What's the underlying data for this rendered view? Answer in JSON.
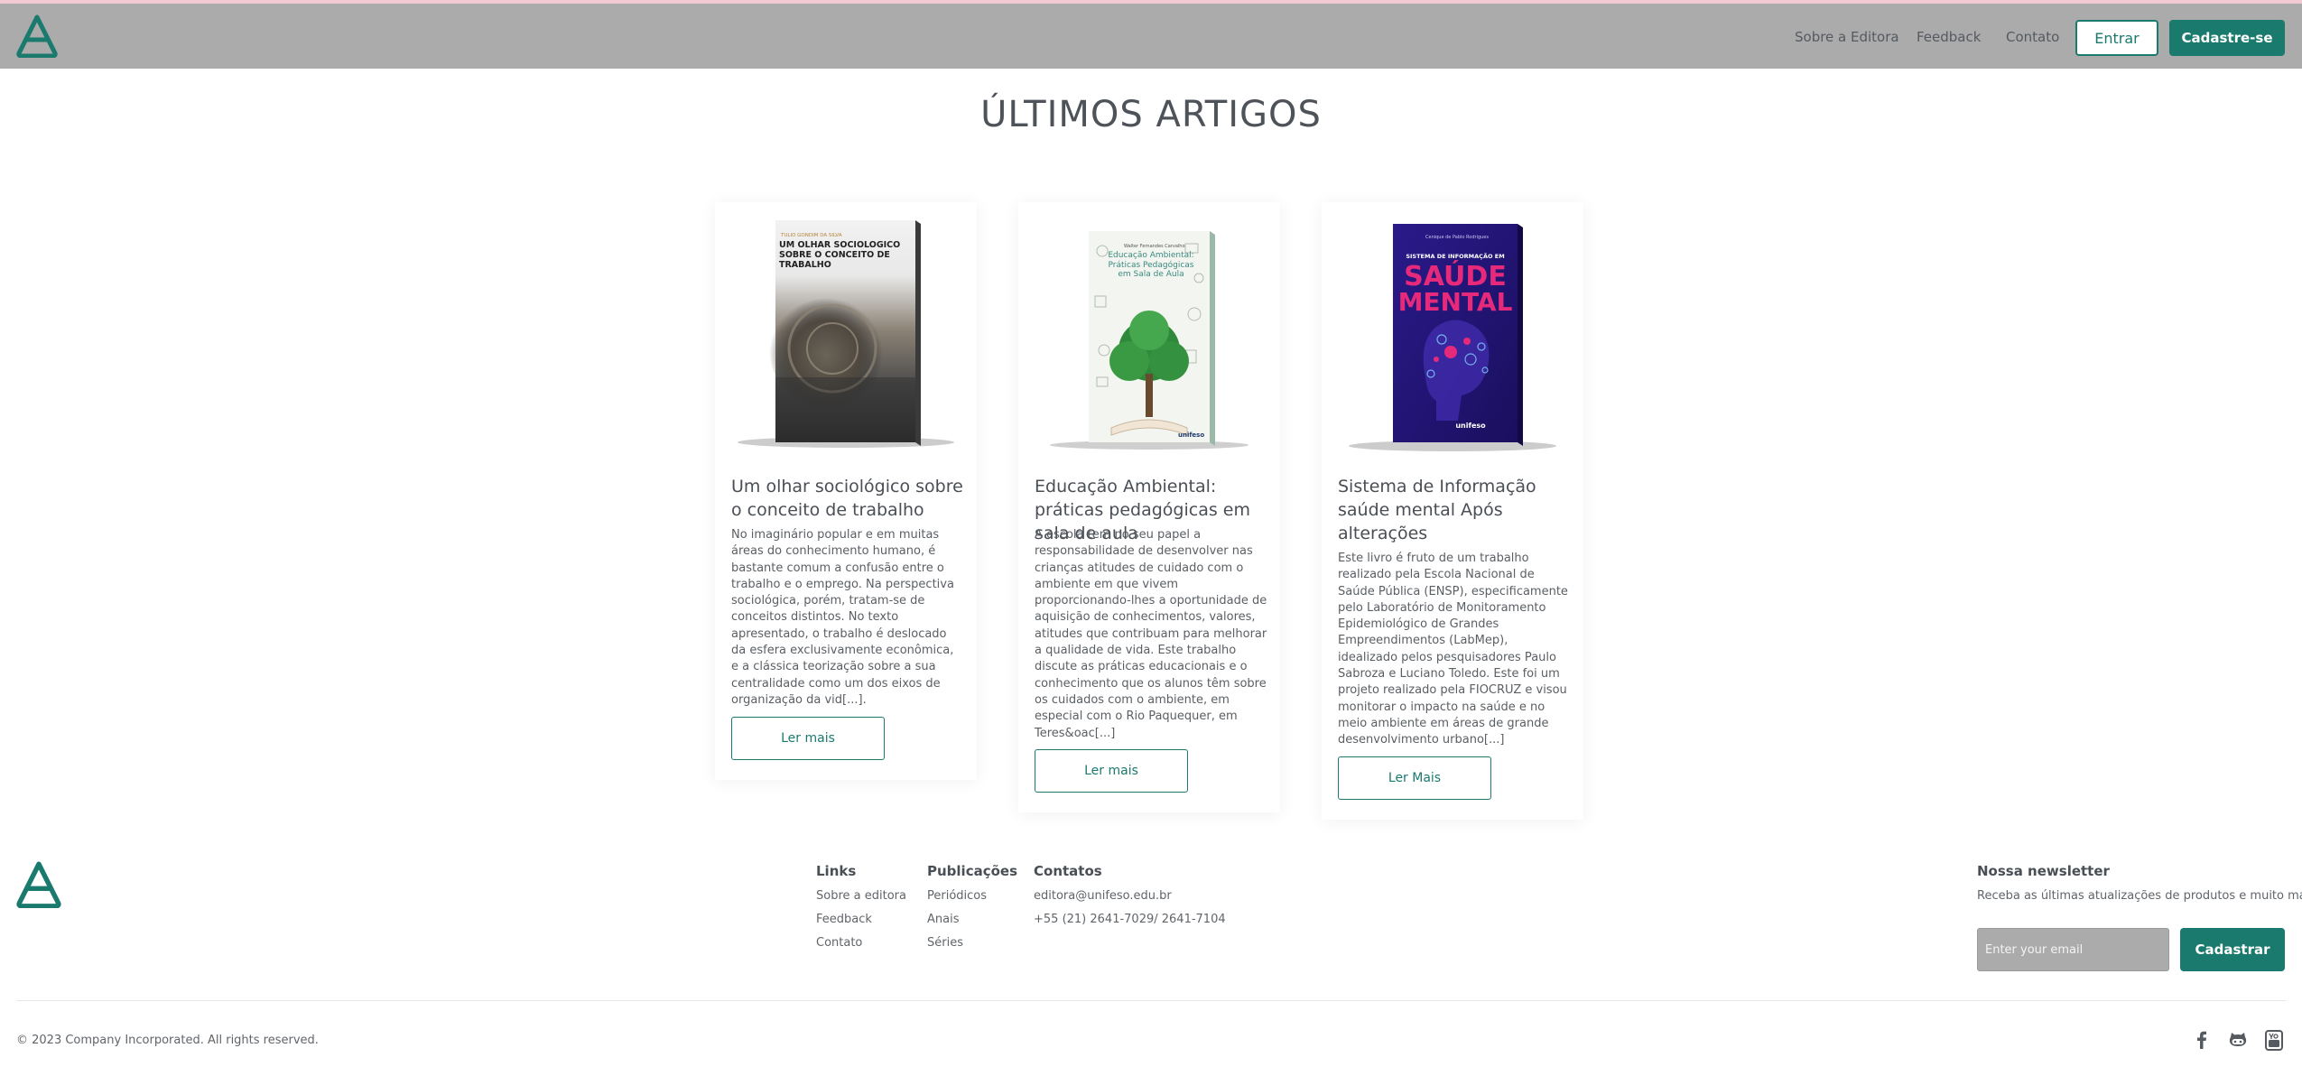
{
  "header": {
    "nav": [
      "Sobre a Editora",
      "Feedback",
      "Contato"
    ],
    "login_label": "Entrar",
    "signup_label": "Cadastre-se"
  },
  "main": {
    "title": "ÚLTIMOS ARTIGOS",
    "articles": [
      {
        "cover": {
          "author": "TULIO GONDIM DA SILVA",
          "title": "UM OLHAR SOCIOLÓGICO SOBRE O CONCEITO DE TRABALHO"
        },
        "title": "Um olhar sociológico sobre o conceito de trabalho",
        "excerpt": "No imaginário popular e em muitas áreas do conhecimento humano, é bastante comum a confusão entre o trabalho e o emprego. Na perspectiva sociológica, porém, tratam-se de conceitos distintos. No texto apresentado, o trabalho é deslocado da esfera exclusivamente econômica, e a clássica teorização sobre a sua centralidade como um dos eixos de organização da vid[...].",
        "button": "Ler mais"
      },
      {
        "cover": {
          "author": "Walter Fernandes Carvalho",
          "title": "Educação Ambiental: Práticas Pedagógicas em Sala de Aula",
          "publisher": "unifeso"
        },
        "title": "Educação Ambiental: práticas pedagógicas em sala de aula",
        "excerpt": "A escola tem no seu papel a responsabilidade de desenvolver nas crianças atitudes de cuidado com o ambiente em que vivem proporcionando-lhes a oportunidade de aquisição de conhecimentos, valores, atitudes que contribuam para melhorar a qualidade de vida. Este trabalho discute as práticas educacionais e o conhecimento que os alunos têm sobre os cuidados com o ambiente, em especial com o Rio Paquequer, em Teres&oac[...]",
        "button": "Ler mais"
      },
      {
        "cover": {
          "author": "Cenique de Pablo Rodrigues",
          "subtitle": "SISTEMA DE INFORMAÇÃO EM",
          "title_line1": "SAÚDE",
          "title_line2": "MENTAL",
          "publisher": "unifeso"
        },
        "title": "Sistema de Informação saúde mental Após alterações",
        "excerpt": "Este livro é fruto de um trabalho realizado pela Escola Nacional de Saúde Pública (ENSP), especificamente pelo Laboratório de Monitoramento Epidemiológico de Grandes Empreendimentos (LabMep), idealizado pelos pesquisadores Paulo Sabroza e Luciano Toledo. Este foi um projeto realizado pela FIOCRUZ e visou monitorar o impacto na saúde e no meio ambiente em áreas de grande desenvolvimento urbano[...]",
        "button": "Ler Mais"
      }
    ]
  },
  "footer": {
    "links": {
      "heading": "Links",
      "items": [
        "Sobre a editora",
        "Feedback",
        "Contato"
      ]
    },
    "publications": {
      "heading": "Publicações",
      "items": [
        "Periódicos",
        "Anais",
        "Séries"
      ]
    },
    "contacts": {
      "heading": "Contatos",
      "items": [
        "editora@unifeso.edu.br",
        "+55 (21) 2641-7029/ 2641-7104"
      ]
    },
    "newsletter": {
      "heading": "Nossa newsletter",
      "text": "Receba as últimas atualizações de produtos e muito mais.",
      "placeholder": "Enter your email",
      "button": "Cadastrar"
    },
    "copyright": "© 2023 Company Incorporated. All rights reserved.",
    "social_icons": [
      "facebook-icon",
      "github-icon",
      "youtube-icon"
    ]
  },
  "colors": {
    "accent": "#1a7a6e",
    "header_bg": "#ababab",
    "top_line": "#f3c9d3"
  }
}
